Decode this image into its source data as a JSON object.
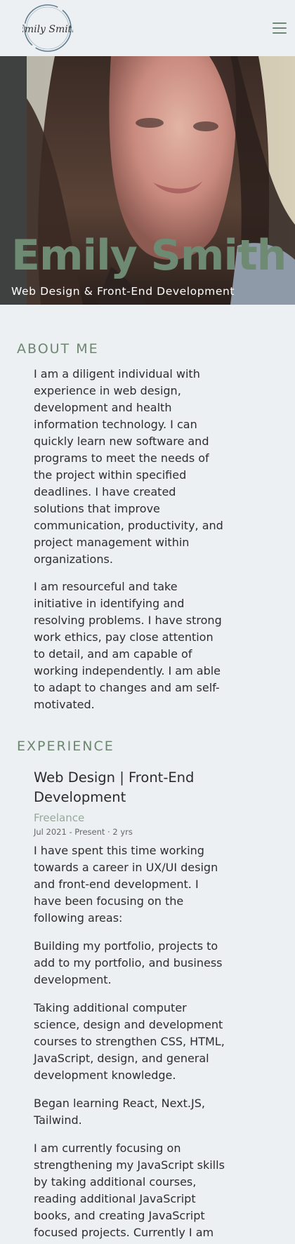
{
  "header": {
    "logo_text": "Emily Smith"
  },
  "hero": {
    "name": "Emily Smith",
    "subtitle": "Web Design & Front-End Development"
  },
  "about": {
    "heading": "ABOUT ME",
    "paragraphs": [
      "I am a diligent individual with experience in web design, development and health information technology. I can quickly learn new software and programs to meet the needs of the project within specified deadlines. I have created solutions that improve communication, productivity, and project management within organizations.",
      "I am resourceful and take initiative in identifying and resolving problems. I have strong work ethics, pay close attention to detail, and am capable of working independently. I am able to adapt to changes and am self-motivated."
    ]
  },
  "experience": {
    "heading": "EXPERIENCE",
    "jobs": [
      {
        "title": "Web Design | Front-End Development",
        "company": "Freelance",
        "dates": "Jul 2021 - Present · 2 yrs",
        "paragraphs": [
          "I have spent this time working towards a career in UX/UI design and front-end development. I have been focusing on the following areas:",
          "Building my portfolio, projects to add to my portfolio, and business development.",
          "Taking additional computer science, design and development courses to strengthen CSS, HTML, JavaScript, design, and general development knowledge.",
          "Began learning React, Next.JS, Tailwind.",
          "I am currently focusing on strengthening my JavaScript skills by taking additional courses, reading additional JavaScript books, and creating JavaScript focused projects. Currently I am working on a drag and drop to do list in JavaScript. Next I will be"
        ]
      }
    ]
  },
  "colors": {
    "accent": "#6f8a72",
    "background": "#edf0f3",
    "hero_side": "#3f4140"
  }
}
